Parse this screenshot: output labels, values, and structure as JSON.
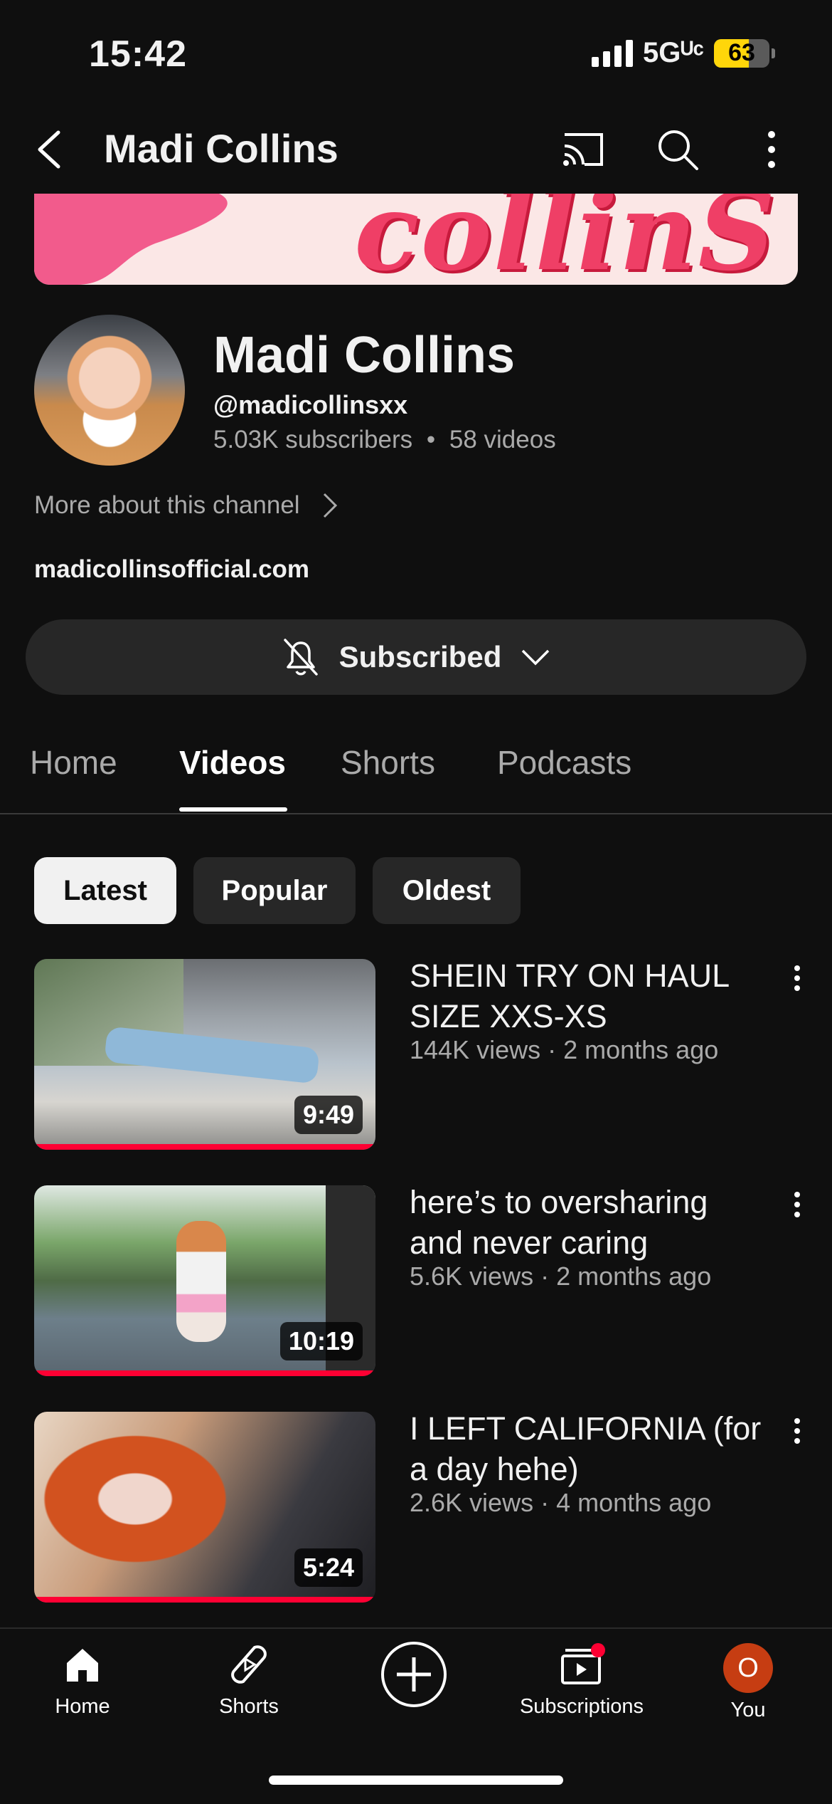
{
  "status_bar": {
    "time": "15:42",
    "network": "5Gᵁᶜ",
    "battery": "63",
    "battery_level": 0.63
  },
  "header": {
    "title": "Madi Collins"
  },
  "banner": {
    "text": "collinS"
  },
  "channel": {
    "name": "Madi Collins",
    "handle": "@madicollinsxx",
    "subscribers": "5.03K subscribers",
    "separator": "•",
    "videos": "58 videos",
    "more_about": "More about this channel",
    "website": "madicollinsofficial.com",
    "subscribe_label": "Subscribed"
  },
  "tabs": [
    {
      "label": "Home"
    },
    {
      "label": "Videos",
      "active": true
    },
    {
      "label": "Shorts"
    },
    {
      "label": "Podcasts"
    }
  ],
  "chips": [
    {
      "label": "Latest",
      "selected": true
    },
    {
      "label": "Popular"
    },
    {
      "label": "Oldest"
    }
  ],
  "videos": [
    {
      "title": "SHEIN TRY ON HAUL SIZE XXS-XS",
      "meta": "144K views · 2 months ago",
      "duration": "9:49"
    },
    {
      "title": "here’s to oversharing and never caring",
      "meta": "5.6K views · 2 months ago",
      "duration": "10:19"
    },
    {
      "title": "I LEFT CALIFORNIA (for a day hehe)",
      "meta": "2.6K views · 4 months ago",
      "duration": "5:24"
    }
  ],
  "bottom_nav": {
    "home": "Home",
    "shorts": "Shorts",
    "subscriptions": "Subscriptions",
    "you": "You",
    "you_avatar_letter": "O"
  },
  "colors": {
    "accent_red": "#ff0033",
    "avatar_orange": "#c63d12",
    "banner_pink": "#ef3f66"
  }
}
